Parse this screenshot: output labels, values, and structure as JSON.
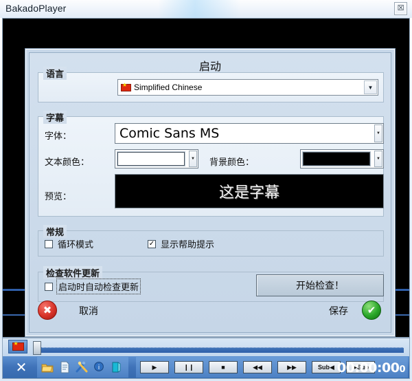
{
  "window": {
    "title": "BakadoPlayer",
    "close_icon": "close-icon",
    "close_glyph": "☒"
  },
  "dialog": {
    "title": "启动",
    "language_group": {
      "label": "语言",
      "selected": "Simplified Chinese",
      "flag_icon": "china-flag-icon",
      "arrow_glyph": "▼"
    },
    "subtitle_group": {
      "label": "字幕",
      "font_label": "字体：",
      "font_value": "Comic Sans MS",
      "text_color_label": "文本颜色：",
      "text_color_value": "#ffffff",
      "bg_color_label": "背景颜色：",
      "bg_color_value": "#000000",
      "preview_label": "预览：",
      "preview_text": "这是字幕",
      "arrow_glyph": "▼"
    },
    "general_group": {
      "label": "常规",
      "loop_mode_label": "循环模式",
      "loop_mode_checked": false,
      "show_tips_label": "显示帮助提示",
      "show_tips_checked": true,
      "check_glyph": "✓"
    },
    "update_group": {
      "label": "检查软件更新",
      "auto_check_label": "启动时自动检查更新",
      "auto_check_checked": false,
      "check_now_button": "开始检查！"
    },
    "footer": {
      "cancel_label": "取消",
      "cancel_icon": "cancel-x-icon",
      "cancel_glyph": "✖",
      "cancel_color": "#d8342a",
      "save_label": "保存",
      "save_icon": "save-check-icon",
      "save_glyph": "✔",
      "save_color": "#2aa72a"
    }
  },
  "bottom_bar": {
    "language_flag_icon": "china-flag-icon",
    "seek_position": 0,
    "close_button_glyph": "✕",
    "tool_icons": [
      {
        "name": "open-folder-icon",
        "color": "#f2c14a"
      },
      {
        "name": "document-icon",
        "color": "#dfeaf4"
      },
      {
        "name": "tools-icon",
        "color": "#3a6fb5"
      },
      {
        "name": "info-icon",
        "color": "#2f6fc0"
      },
      {
        "name": "exit-door-icon",
        "color": "#19b9d6"
      }
    ],
    "playback_buttons": [
      {
        "name": "play-button",
        "glyph": "▶"
      },
      {
        "name": "pause-button",
        "glyph": "❙❙"
      },
      {
        "name": "stop-button",
        "glyph": "■"
      },
      {
        "name": "rewind-button",
        "glyph": "◀◀"
      },
      {
        "name": "forward-button",
        "glyph": "▶▶"
      },
      {
        "name": "prev-subtitle-button",
        "glyph": "Sub◀"
      },
      {
        "name": "next-subtitle-button",
        "glyph": "▶Sub"
      }
    ],
    "time_display": "00:00:00",
    "time_extra": "0"
  }
}
